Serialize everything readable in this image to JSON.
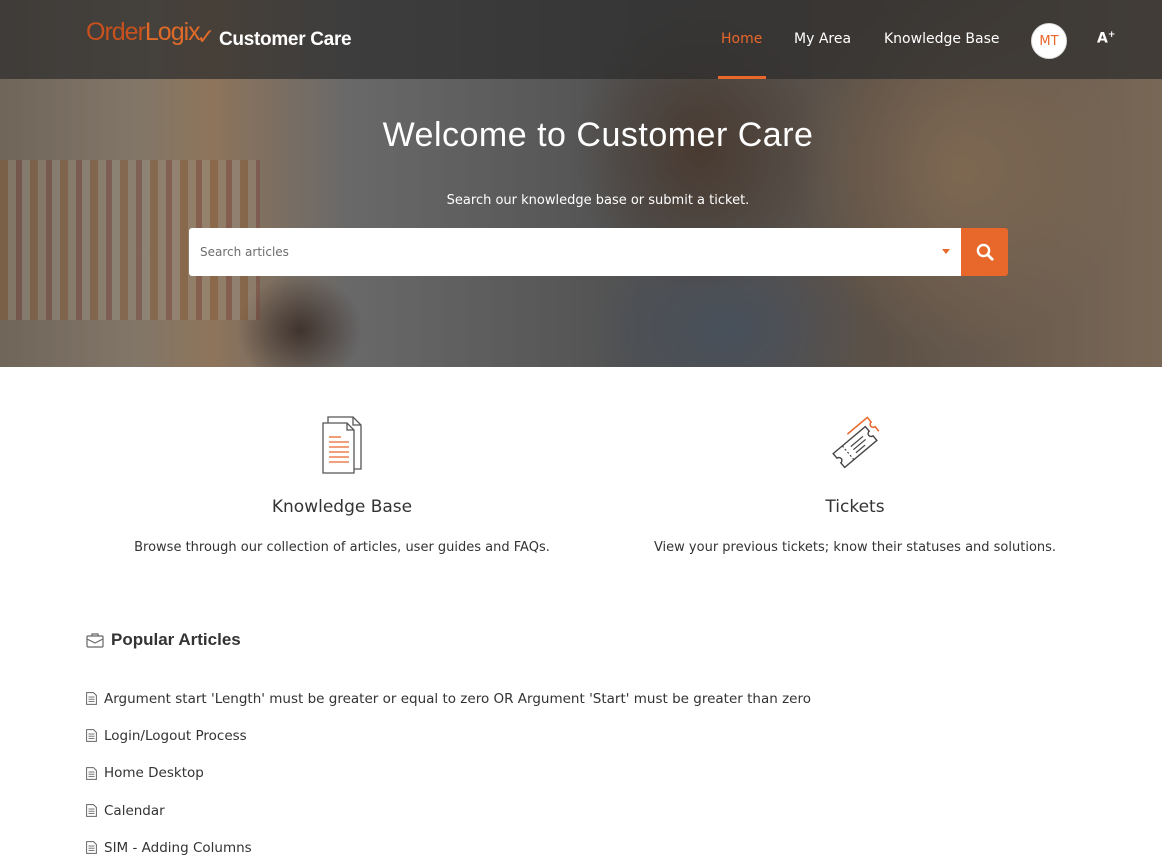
{
  "header": {
    "logo_order": "Order",
    "logo_logix": "Logix",
    "brand_title": "Customer Care",
    "nav": [
      {
        "label": "Home",
        "active": true
      },
      {
        "label": "My Area",
        "active": false
      },
      {
        "label": "Knowledge Base",
        "active": false
      }
    ],
    "avatar_initials": "MT",
    "font_toggle_label": "A",
    "accent_color": "#e8672a"
  },
  "hero": {
    "title": "Welcome to Customer Care",
    "subtitle": "Search our knowledge base or submit a ticket.",
    "search_placeholder": "Search articles",
    "search_icon": "search-icon"
  },
  "cards": [
    {
      "icon": "document-icon",
      "title": "Knowledge Base",
      "description": "Browse through our collection of articles, user guides and FAQs."
    },
    {
      "icon": "ticket-icon",
      "title": "Tickets",
      "description": "View your previous tickets; know their statuses and solutions."
    }
  ],
  "popular": {
    "icon": "briefcase-icon",
    "title": "Popular Articles",
    "articles": [
      "Argument start 'Length' must be greater or equal to zero OR Argument 'Start' must be greater than zero",
      "Login/Logout Process",
      "Home Desktop",
      "Calendar",
      "SIM - Adding Columns"
    ]
  }
}
